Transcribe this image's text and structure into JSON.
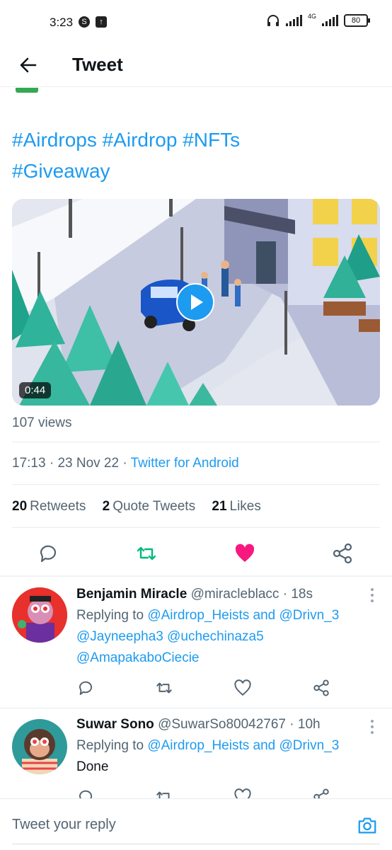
{
  "status_bar": {
    "time": "3:23",
    "network": "4G",
    "battery": "80"
  },
  "header": {
    "title": "Tweet"
  },
  "tweet": {
    "hashtags_line1": "#Airdrops #Airdrop #NFTs",
    "hashtags_line2": "#Giveaway",
    "video_duration": "0:44",
    "views": "107 views",
    "time": "17:13",
    "date": "23 Nov 22",
    "source": "Twitter for Android",
    "retweets_count": "20",
    "retweets_label": "Retweets",
    "quotes_count": "2",
    "quotes_label": "Quote Tweets",
    "likes_count": "21",
    "likes_label": "Likes"
  },
  "colors": {
    "accent": "#1d9bf0",
    "like": "#f91880",
    "retweet": "#00ba7c"
  },
  "replies": [
    {
      "name": "Benjamin Miracle",
      "handle": "@miracleblacc",
      "time": "· 18s",
      "replying_prefix": "Replying to ",
      "mention1": "@Airdrop_Heists",
      "and1": " and ",
      "mention2": "@Drivn_3",
      "body_line1": "@Jayneepha3 @uchechinaza5",
      "body_line2": "@AmapakaboCiecie"
    },
    {
      "name": "Suwar Sono",
      "handle": "@SuwarSo80042767",
      "time": "· 10h",
      "replying_prefix": "Replying to ",
      "mention1": "@Airdrop_Heists",
      "and1": " and ",
      "mention2": "@Drivn_3",
      "body_line1": "Done"
    }
  ],
  "composer": {
    "placeholder": "Tweet your reply"
  }
}
